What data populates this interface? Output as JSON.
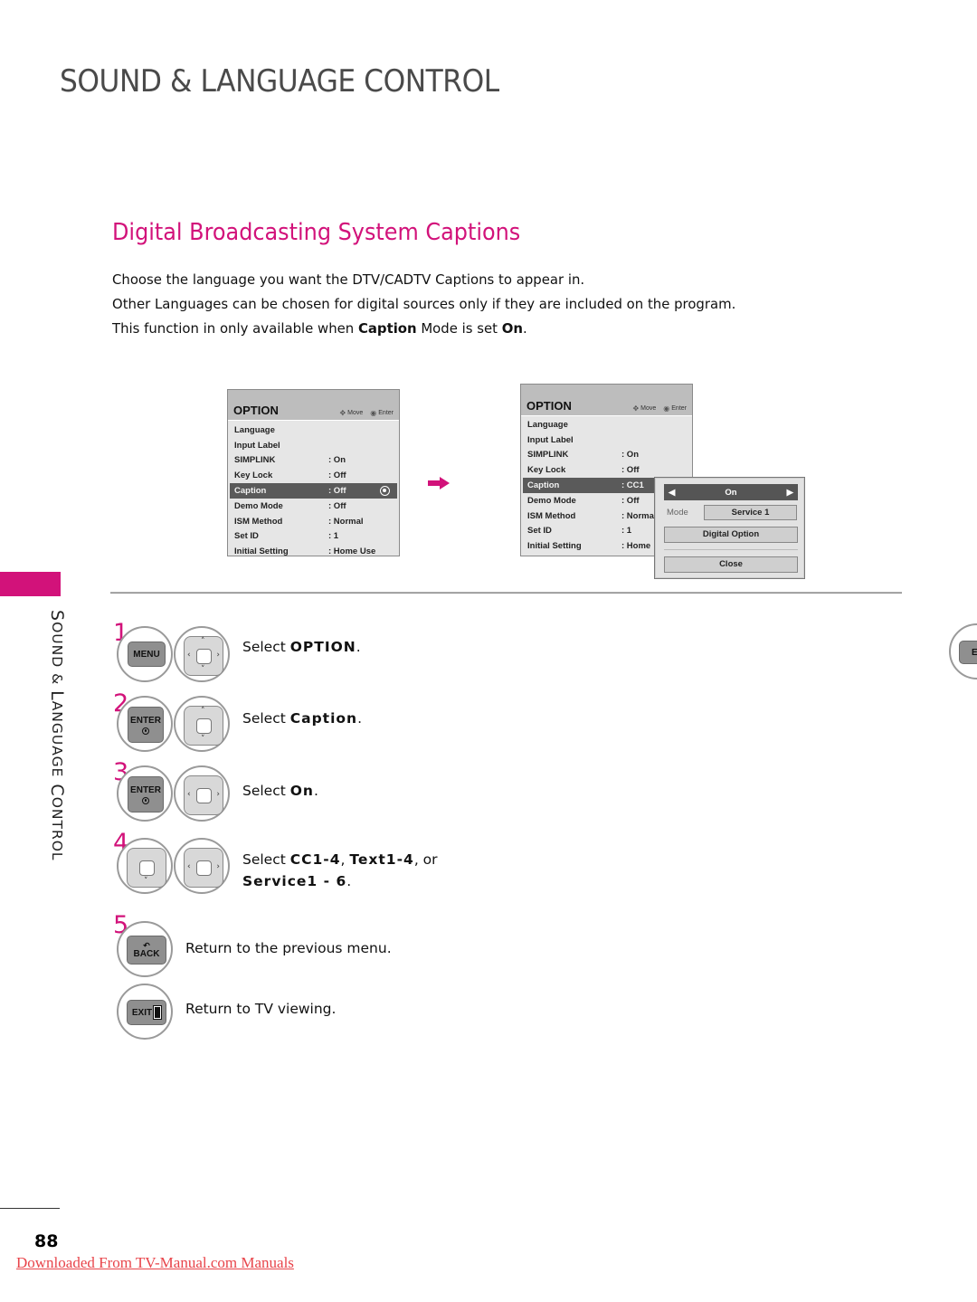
{
  "page": {
    "header_title": "SOUND & LANGUAGE CONTROL",
    "section_title": "Digital Broadcasting System Captions",
    "intro": {
      "line1": "Choose the language you want the DTV/CADTV Captions to appear in.",
      "line2": "Other Languages can be chosen for digital sources only if they are included on the program.",
      "line3_pre": "This function in only available when ",
      "line3_b1": "Caption",
      "line3_mid": " Mode is set ",
      "line3_b2": "On",
      "line3_end": "."
    },
    "side_label": {
      "s1": "S",
      "w1": "OUND",
      "amp": " & ",
      "s2": "L",
      "w2": "ANGUAGE",
      "s3": " C",
      "w3": "ONTROL"
    },
    "page_number": "88",
    "footer_link": "Downloaded From TV-Manual.com Manuals",
    "accent_color": "#d2127a"
  },
  "osd_left": {
    "title": "OPTION",
    "hint_move": "Move",
    "hint_enter": "Enter",
    "rows": [
      {
        "key": "Language",
        "value": ""
      },
      {
        "key": "Input Label",
        "value": ""
      },
      {
        "key": "SIMPLINK",
        "value": ": On"
      },
      {
        "key": "Key Lock",
        "value": ": Off"
      },
      {
        "key": "Caption",
        "value": ": Off",
        "selected": true
      },
      {
        "key": "Demo Mode",
        "value": ": Off"
      },
      {
        "key": "ISM Method",
        "value": ": Normal"
      },
      {
        "key": "Set ID",
        "value": ": 1"
      },
      {
        "key": "Initial Setting",
        "value": ": Home Use"
      }
    ]
  },
  "osd_right": {
    "title": "OPTION",
    "hint_move": "Move",
    "hint_enter": "Enter",
    "rows": [
      {
        "key": "Language",
        "value": ""
      },
      {
        "key": "Input Label",
        "value": ""
      },
      {
        "key": "SIMPLINK",
        "value": ": On"
      },
      {
        "key": "Key Lock",
        "value": ": Off"
      },
      {
        "key": "Caption",
        "value": ": CC1",
        "selected": true
      },
      {
        "key": "Demo Mode",
        "value": ": Off"
      },
      {
        "key": "ISM Method",
        "value": ": Normal"
      },
      {
        "key": "Set ID",
        "value": ": 1"
      },
      {
        "key": "Initial Setting",
        "value": ": Home"
      }
    ],
    "popup": {
      "toggle_value": "On",
      "mode_label": "Mode",
      "mode_value": "Service 1",
      "digital_option": "Digital Option",
      "close": "Close"
    }
  },
  "steps": [
    {
      "num": "1",
      "keys": [
        "MENU",
        "dpad-all"
      ],
      "pre": "Select ",
      "bold": "OPTION",
      "post": "."
    },
    {
      "num": "2",
      "keys": [
        "ENTER",
        "dpad-updown"
      ],
      "pre": "Select ",
      "bold": "Caption",
      "post": "."
    },
    {
      "num": "3",
      "keys": [
        "ENTER",
        "dpad-leftright"
      ],
      "pre": "Select ",
      "bold": "On",
      "post": "."
    },
    {
      "num": "4",
      "keys": [
        "dpad-down",
        "dpad-leftright"
      ],
      "pre": "Select ",
      "bold": "CC1-4",
      "mid": ", ",
      "bold2": "Text1-4",
      "mid2": ", or",
      "bold3": "Service1 - 6",
      "post": "."
    },
    {
      "num": "5",
      "keys": [
        "BACK"
      ],
      "text": "Return to the previous menu."
    },
    {
      "num": "",
      "keys": [
        "EXIT"
      ],
      "text": "Return to TV viewing."
    }
  ],
  "keys": {
    "menu": "MENU",
    "enter": "ENTER",
    "back": "BACK",
    "exit": "EXIT",
    "side_exit": "EXI"
  }
}
